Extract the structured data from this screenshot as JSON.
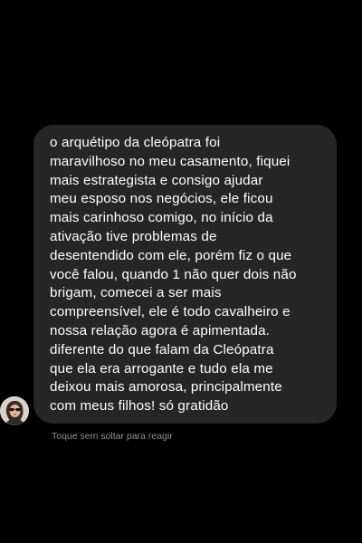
{
  "colors": {
    "background": "#000000",
    "bubble": "#262626",
    "message_text": "#ffffff",
    "hint_text": "#8e8e8e"
  },
  "sender": {
    "avatar_icon": "profile-photo"
  },
  "message": {
    "lines": [
      "o arquétipo da cleópatra foi",
      "maravilhoso no meu casamento, fiquei",
      "mais estrategista e consigo ajudar",
      "meu esposo nos negócios, ele ficou",
      "mais carinhoso comigo, no início da",
      "ativação tive problemas de",
      "desentendido com ele, porém fiz o que",
      "você falou, quando 1 não quer dois não",
      "brigam, comecei a ser mais",
      "compreensível, ele é todo cavalheiro e",
      "nossa relação agora é apimentada.",
      "diferente do que falam da Cleópatra",
      "que ela era arrogante e tudo ela me",
      "deixou mais amorosa, principalmente",
      "com meus filhos! só gratidão"
    ]
  },
  "hint": "Toque sem soltar para reagir"
}
